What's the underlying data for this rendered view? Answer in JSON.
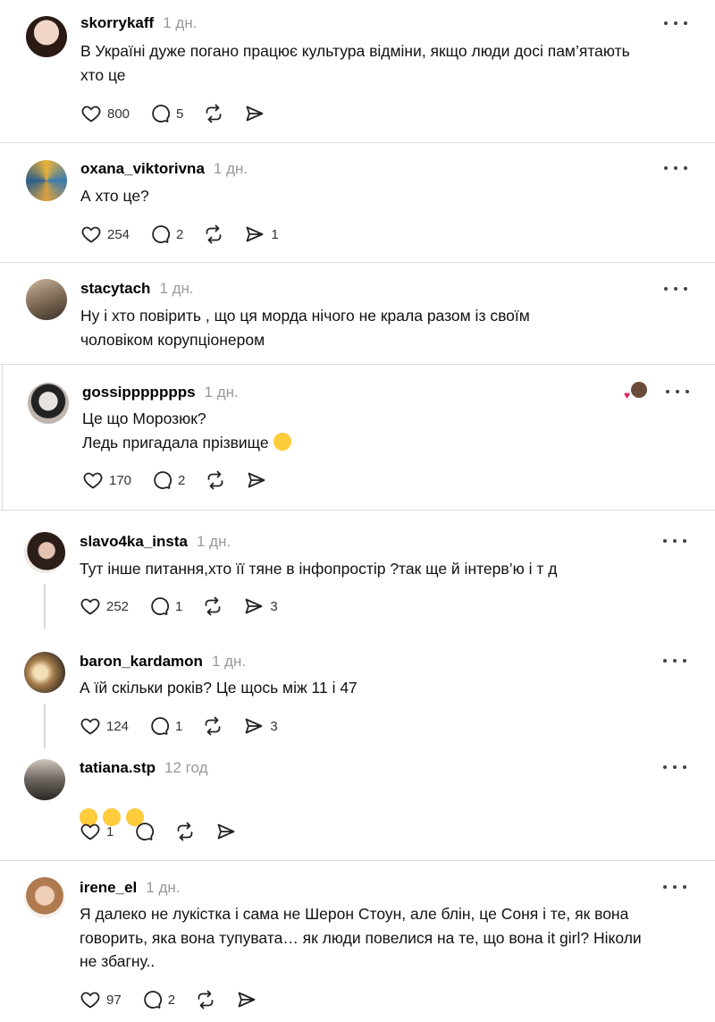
{
  "posts": [
    {
      "username": "skorrykaff",
      "time": "1 дн.",
      "text": "В Україні дуже погано працює культура відміни, якщо люди досі пам’ятають\nхто це",
      "likes": "800",
      "replies": "5",
      "reposts": "",
      "shares": ""
    },
    {
      "username": "oxana_viktorivna",
      "time": "1 дн.",
      "text": "А хто це?",
      "likes": "254",
      "replies": "2",
      "reposts": "",
      "shares": "1"
    },
    {
      "username": "stacytach",
      "time": "1 дн.",
      "text": "Ну і хто повірить , що ця морда нічого не крала разом із своїм\nчоловіком корупціонером"
    },
    {
      "username": "gossippppppps",
      "time": "1 дн.",
      "text": "Це що Морозюк?\nЛедь пригадала прізвище",
      "likes": "170",
      "replies": "2",
      "reposts": "",
      "shares": ""
    },
    {
      "username": "slavo4ka_insta",
      "time": "1 дн.",
      "text": "Тут інше питання,хто її тяне в інфопростір ?так ще й інтерв’ю і т д",
      "likes": "252",
      "replies": "1",
      "reposts": "",
      "shares": "3"
    },
    {
      "username": "baron_kardamon",
      "time": "1 дн.",
      "text": "А їй скільки років? Це щось між 11 і 47",
      "likes": "124",
      "replies": "1",
      "reposts": "",
      "shares": "3"
    },
    {
      "username": "tatiana.stp",
      "time": "12 год",
      "text": "",
      "likes": "1",
      "replies": "",
      "reposts": "",
      "shares": ""
    },
    {
      "username": "irene_el",
      "time": "1 дн.",
      "text": "Я далеко не лукістка і сама не Шерон Стоун, але блін, це Соня і те, як вона\nговорить, яка вона тупувата… як люди повелися на те, що вона it girl? Ніколи\nне збагну..",
      "likes": "97",
      "replies": "2",
      "reposts": "",
      "shares": ""
    }
  ],
  "icons": {
    "like": "heart-icon",
    "reply": "comment-icon",
    "repost": "repost-icon",
    "share": "send-icon",
    "more": "more-icon",
    "emoji": "grinning-sweat-emoji",
    "laugh": "tears-of-joy-emoji"
  }
}
